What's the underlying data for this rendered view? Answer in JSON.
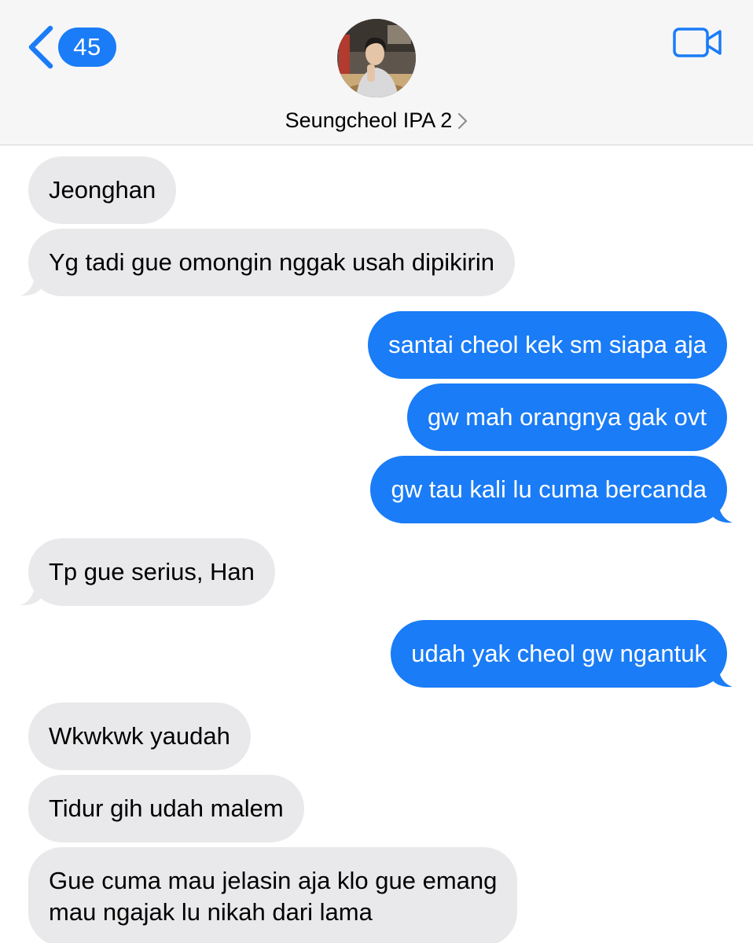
{
  "header": {
    "back_badge": "45",
    "contact_name": "Seungcheol IPA 2",
    "avatar": "avatar-photo",
    "video_icon": "video-camera-icon"
  },
  "colors": {
    "accent": "#1a7cf6",
    "incoming_bubble": "#e9e9eb",
    "header_bg": "#f6f6f7"
  },
  "messages": [
    {
      "from": "them",
      "text": "Jeonghan"
    },
    {
      "from": "them",
      "text": "Yg tadi gue omongin nggak usah dipikirin"
    },
    {
      "from": "me",
      "text": "santai cheol kek sm siapa aja"
    },
    {
      "from": "me",
      "text": "gw mah orangnya gak ovt"
    },
    {
      "from": "me",
      "text": "gw tau kali lu cuma bercanda"
    },
    {
      "from": "them",
      "text": "Tp gue serius, Han"
    },
    {
      "from": "me",
      "text": "udah yak cheol gw ngantuk"
    },
    {
      "from": "them",
      "text": "Wkwkwk yaudah"
    },
    {
      "from": "them",
      "text": "Tidur gih udah malem"
    },
    {
      "from": "them",
      "text": "Gue cuma mau jelasin aja klo gue emang\nmau ngajak lu nikah dari lama"
    }
  ]
}
